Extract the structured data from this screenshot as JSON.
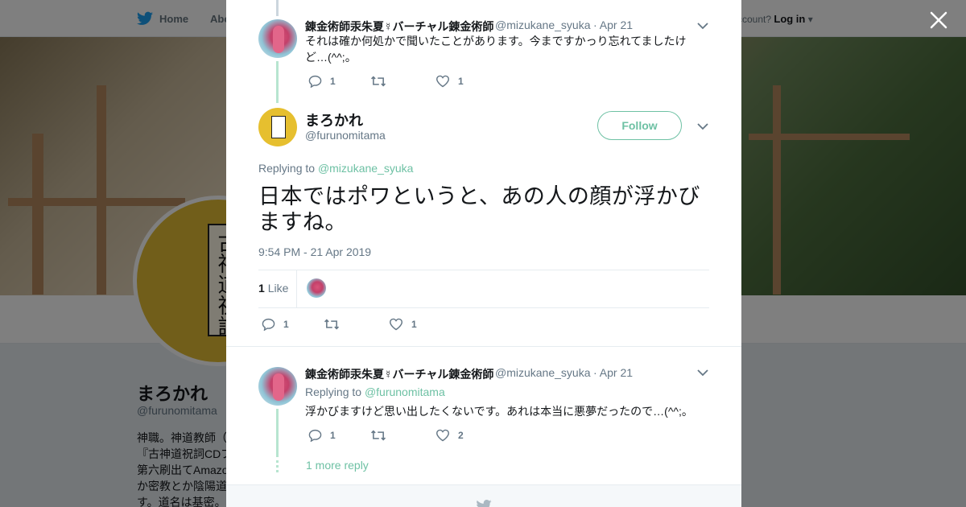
{
  "topnav": {
    "home_label": "Home",
    "about_label": "Abo",
    "login_prefix": "ccount?",
    "login_label": "Log in"
  },
  "profile": {
    "name": "まろかれ",
    "handle": "@furunomitama",
    "bio_lines": [
      "神職。神道教師（",
      "『古神道祝詞CDブ",
      "第六刷出てAmazo",
      "か密教とか陰陽道",
      "す。道名は基密。"
    ],
    "avatar_book_text": "古神道祝詞"
  },
  "thread": {
    "reply1": {
      "name": "錬金術師汞朱夏☿バーチャル錬金術師",
      "handle": "@mizukane_syuka",
      "date": "· Apr 21",
      "text": "それは確か何処かで聞いたことがあります。今まですかっり忘れてましたけど…(^^;。",
      "reply_count": "1",
      "retweet_count": "",
      "like_count": "1"
    },
    "main": {
      "name": "まろかれ",
      "handle": "@furunomitama",
      "follow_label": "Follow",
      "replying_prefix": "Replying to",
      "replying_to": "@mizukane_syuka",
      "text": "日本ではポワというと、あの人の顔が浮かびますね。",
      "timestamp": "9:54 PM - 21 Apr 2019",
      "likes_number": "1",
      "likes_label": "Like",
      "reply_count": "1",
      "retweet_count": "",
      "like_count": "1"
    },
    "reply2": {
      "name": "錬金術師汞朱夏☿バーチャル錬金術師",
      "handle": "@mizukane_syuka",
      "date": "· Apr 21",
      "replying_prefix": "Replying to",
      "replying_to": "@furunomitama",
      "text": "浮かびますけど思い出したくないです。あれは本当に悪夢だったので…(^^;。",
      "reply_count": "1",
      "retweet_count": "",
      "like_count": "2"
    },
    "more_replies_label": "1 more reply"
  },
  "colors": {
    "accent": "#6ec1a4",
    "twitter_blue": "#1da1f2",
    "muted": "#657786"
  }
}
